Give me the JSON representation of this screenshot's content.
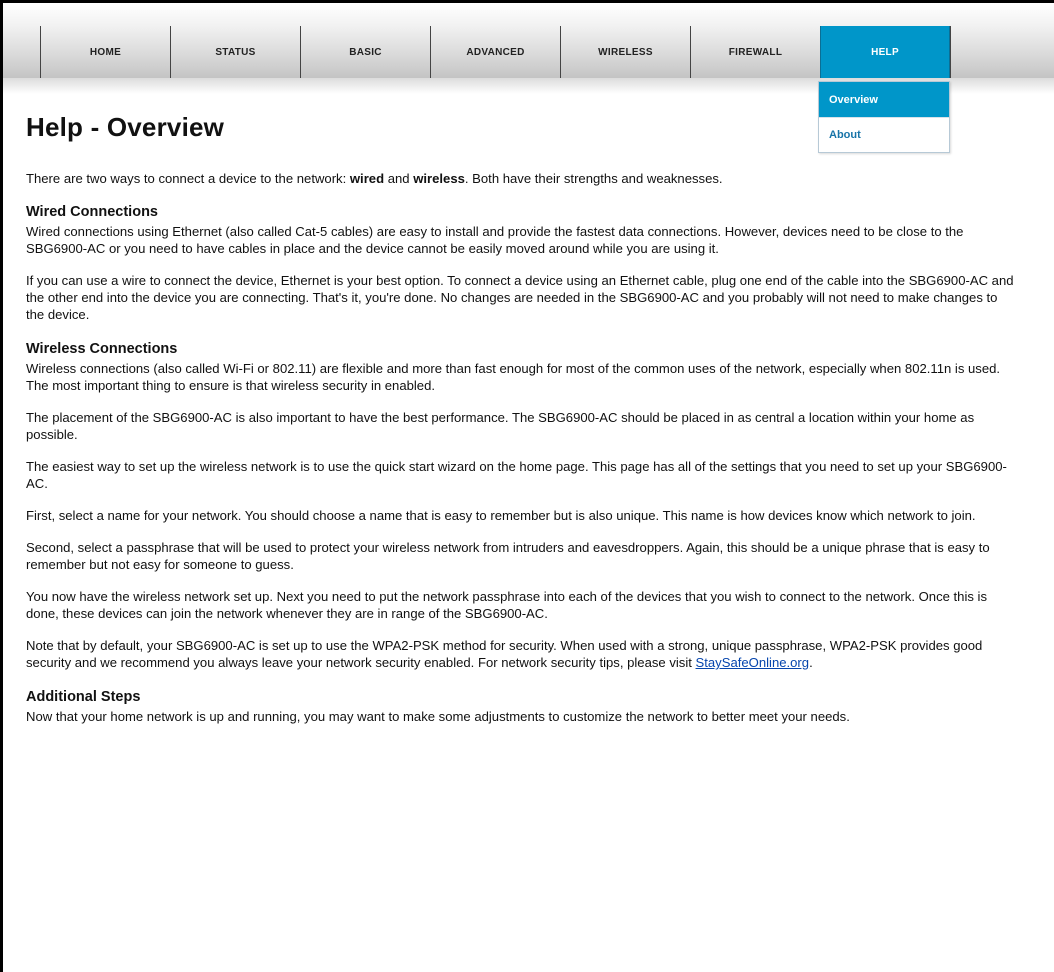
{
  "nav": {
    "items": [
      {
        "label": "HOME"
      },
      {
        "label": "STATUS"
      },
      {
        "label": "BASIC"
      },
      {
        "label": "ADVANCED"
      },
      {
        "label": "WIRELESS"
      },
      {
        "label": "FIREWALL"
      },
      {
        "label": "HELP"
      }
    ],
    "active": "HELP"
  },
  "help_menu": {
    "items": [
      {
        "label": "Overview"
      },
      {
        "label": "About"
      }
    ]
  },
  "page": {
    "title": "Help - Overview",
    "intro": {
      "prefix": "There are two ways to connect a device to the network: ",
      "wired": "wired",
      "and": " and ",
      "wireless": "wireless",
      "suffix": ". Both have their strengths and weaknesses."
    },
    "sections": {
      "wired": {
        "heading": "Wired Connections",
        "p1": "Wired connections using Ethernet (also called Cat-5 cables) are easy to install and provide the fastest data connections. However, devices need to be close to the SBG6900-AC or you need to have cables in place and the device cannot be easily moved around while you are using it.",
        "p2": "If you can use a wire to connect the device, Ethernet is your best option. To connect a device using an Ethernet cable, plug one end of the cable into the SBG6900-AC and the other end into the device you are connecting. That's it, you're done. No changes are needed in the SBG6900-AC and you probably will not need to make changes to the device."
      },
      "wireless": {
        "heading": "Wireless Connections",
        "p1": "Wireless connections (also called Wi-Fi or 802.11) are flexible and more than fast enough for most of the common uses of the network, especially when 802.11n is used. The most important thing to ensure is that wireless security in enabled.",
        "p2": "The placement of the SBG6900-AC is also important to have the best performance. The SBG6900-AC should be placed in as central a location within your home as possible.",
        "p3": "The easiest way to set up the wireless network is to use the quick start wizard on the home page. This page has all of the settings that you need to set up your SBG6900-AC.",
        "p4": "First, select a name for your network. You should choose a name that is easy to remember but is also unique. This name is how devices know which network to join.",
        "p5": "Second, select a passphrase that will be used to protect your wireless network from intruders and eavesdroppers. Again, this should be a unique phrase that is easy to remember but not easy for someone to guess.",
        "p6": "You now have the wireless network set up. Next you need to put the network passphrase into each of the devices that you wish to connect to the network. Once this is done, these devices can join the network whenever they are in range of the SBG6900-AC.",
        "p7_text": "Note that by default, your SBG6900-AC is set up to use the WPA2-PSK method for security. When used with a strong, unique passphrase, WPA2-PSK provides good security and we recommend you always leave your network security enabled. For network security tips, please visit ",
        "p7_link": "StaySafeOnline.org",
        "p7_end": "."
      },
      "additional": {
        "heading": "Additional Steps",
        "p1": "Now that your home network is up and running, you may want to make some adjustments to customize the network to better meet your needs."
      }
    }
  },
  "colors": {
    "accent": "#0096c9",
    "menu_text": "#1874a8",
    "link": "#0645ad"
  }
}
